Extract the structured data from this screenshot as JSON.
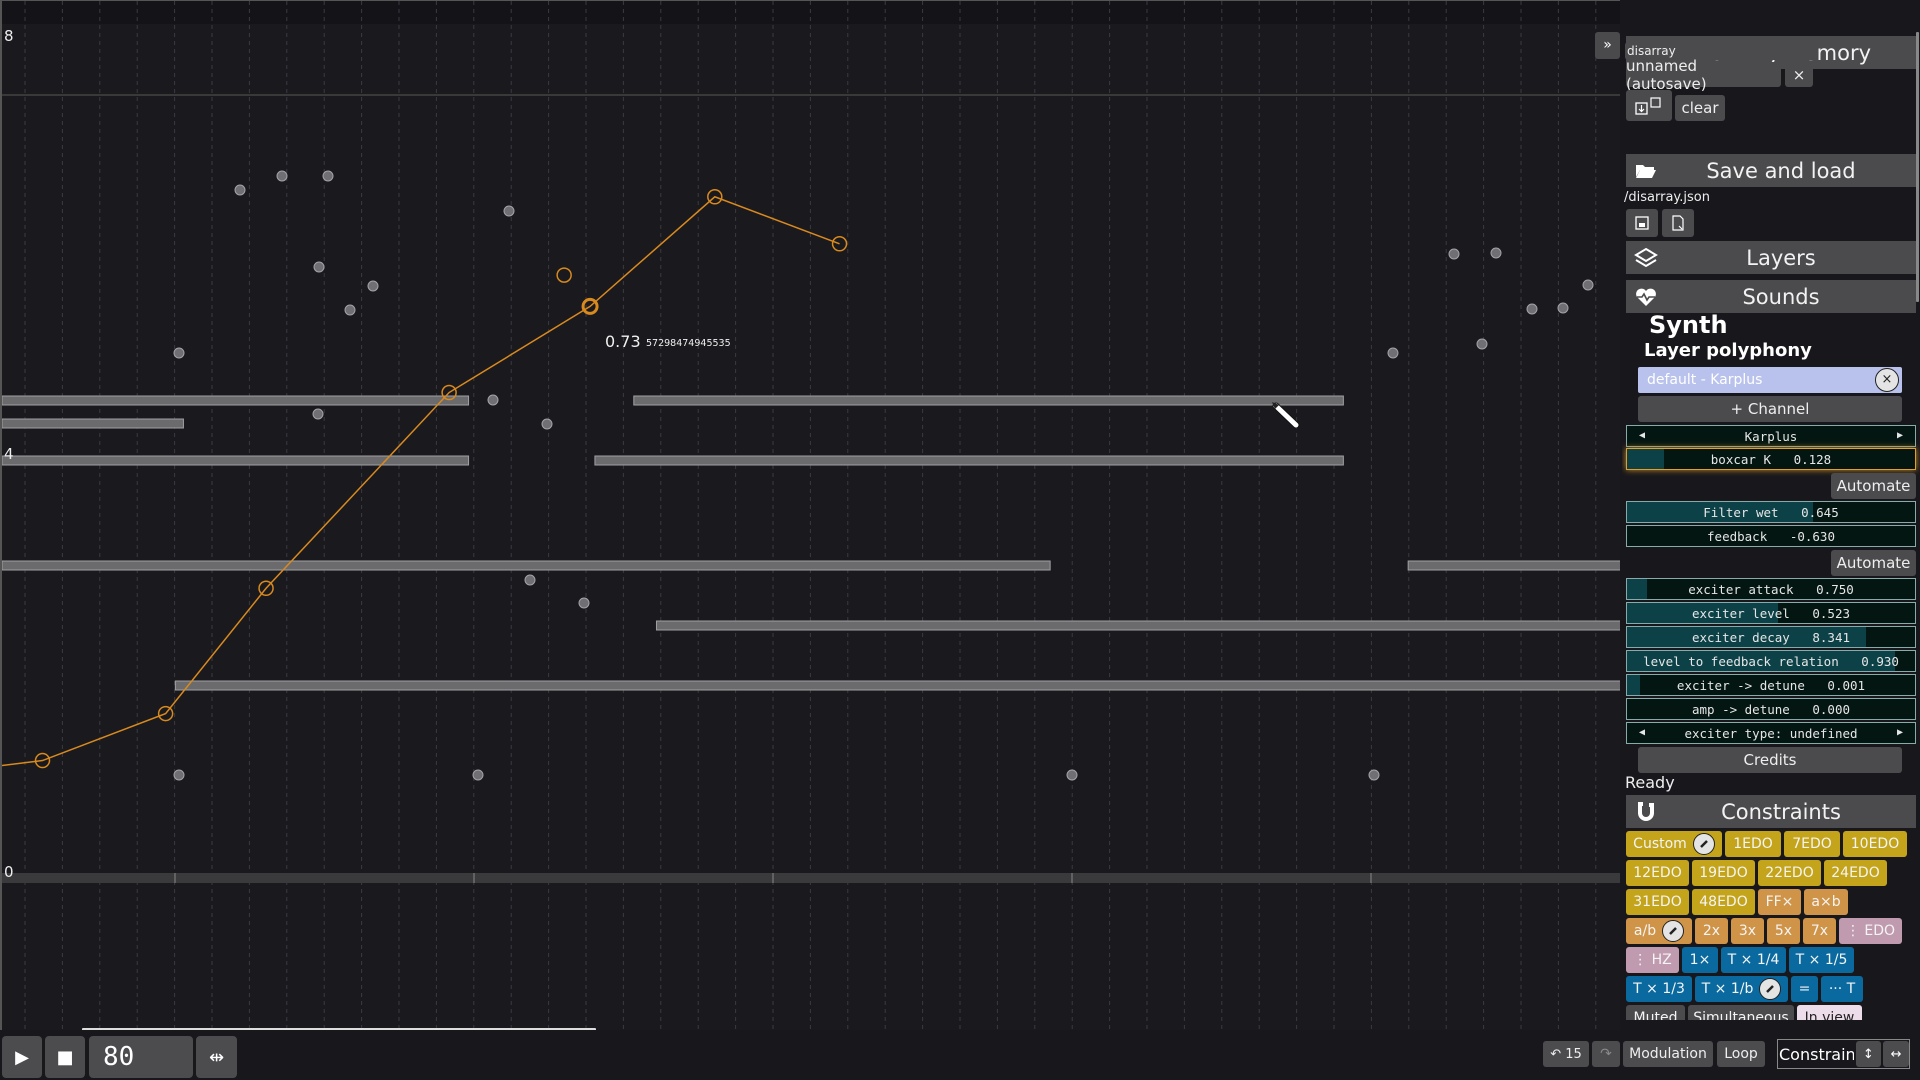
{
  "canvas": {
    "y_labels": [
      "8",
      "4",
      "0"
    ],
    "collapse_label": "»",
    "selected_value": "0.73",
    "selected_value_extra": "57298474945535",
    "horizontal_rows": [
      {
        "start": 0.0,
        "end": 0.288,
        "row": 0
      },
      {
        "start": 0.39,
        "end": 0.828,
        "row": 0
      },
      {
        "start": 0.0,
        "end": 0.112,
        "row": 1
      },
      {
        "start": 0.0,
        "end": 0.288,
        "row": 2
      },
      {
        "start": 0.366,
        "end": 0.828,
        "row": 2
      },
      {
        "start": 0.0,
        "end": 0.647,
        "row": 3
      },
      {
        "start": 0.868,
        "end": 1.0,
        "row": 3
      },
      {
        "start": 0.404,
        "end": 1.0,
        "row": 4
      },
      {
        "start": 0.107,
        "end": 1.0,
        "row": 5
      }
    ],
    "automation_points": [
      {
        "t": 0.025,
        "v": 0.15
      },
      {
        "t": 0.101,
        "v": 0.21
      },
      {
        "t": 0.163,
        "v": 0.37
      },
      {
        "t": 0.276,
        "v": 0.62
      },
      {
        "t": 0.363,
        "v": 0.73
      },
      {
        "t": 0.44,
        "v": 0.87
      },
      {
        "t": 0.517,
        "v": 0.81
      }
    ],
    "ghost_point": {
      "t": 0.347,
      "v": 0.77
    },
    "scroll_position": 0.05,
    "scroll_size": 0.32
  },
  "transport": {
    "play_icon": "▶",
    "stop_icon": "■",
    "tempo": "80",
    "fit_icon": "⇹"
  },
  "bottom_bar": {
    "undo_label": "↶ 15",
    "redo_label": "↷",
    "modulation_label": "Modulation",
    "loop_label": "Loop",
    "constrain_label": "Constrain",
    "vertical_icon": "↕",
    "horizontal_icon": "↔"
  },
  "panel": {
    "working_memory": {
      "title": "Working memory",
      "name_input": "disarray",
      "autosave_label": "unnamed (autosave)",
      "close_label": "×",
      "clear_label": "clear"
    },
    "save_load": {
      "title": "Save and load",
      "path": "/disarray.json"
    },
    "layers": {
      "title": "Layers"
    },
    "sounds": {
      "title": "Sounds",
      "synth_title": "Synth",
      "polyphony_title": "Layer polyphony",
      "channel": "default - Karplus",
      "channel_remove": "×",
      "add_channel": "+ Channel",
      "instrument": "Karplus",
      "automate_label": "Automate",
      "params_a": [
        {
          "label": "boxcar K",
          "value": "0.128",
          "fill": 0.13
        }
      ],
      "params_b": [
        {
          "label": "Filter wet",
          "value": "0.645",
          "fill": 0.645
        },
        {
          "label": "feedback",
          "value": "-0.630",
          "fill": 0.0
        }
      ],
      "params_c": [
        {
          "label": "exciter attack",
          "value": "0.750",
          "fill": 0.07
        },
        {
          "label": "exciter level",
          "value": "0.523",
          "fill": 0.523
        },
        {
          "label": "exciter decay",
          "value": "8.341",
          "fill": 0.83
        },
        {
          "label": "level to feedback relation",
          "value": "0.930",
          "fill": 0.93
        },
        {
          "label": "exciter -> detune",
          "value": "0.001",
          "fill": 0.045
        },
        {
          "label": "amp -> detune",
          "value": "0.000",
          "fill": 0.0
        }
      ],
      "exciter_type": "exciter type: undefined",
      "credits_label": "Credits",
      "status": "Ready"
    },
    "constraints": {
      "title": "Constraints",
      "row1": [
        "Custom",
        "1EDO",
        "7EDO",
        "10EDO"
      ],
      "row2": [
        "12EDO",
        "19EDO",
        "22EDO",
        "24EDO"
      ],
      "row3": [
        "31EDO",
        "48EDO",
        "FF×",
        "a×b"
      ],
      "row4": [
        "a/b",
        "2x",
        "3x",
        "5x",
        "7x",
        "⋮ EDO"
      ],
      "row5": [
        "⋮ HZ",
        "1×",
        "T × 1/4",
        "T × 1/5"
      ],
      "row6": [
        "T × 1/3",
        "T × 1/b",
        "=",
        "··· T"
      ],
      "row7": [
        "Muted",
        "Simultaneous",
        "In view"
      ]
    }
  }
}
